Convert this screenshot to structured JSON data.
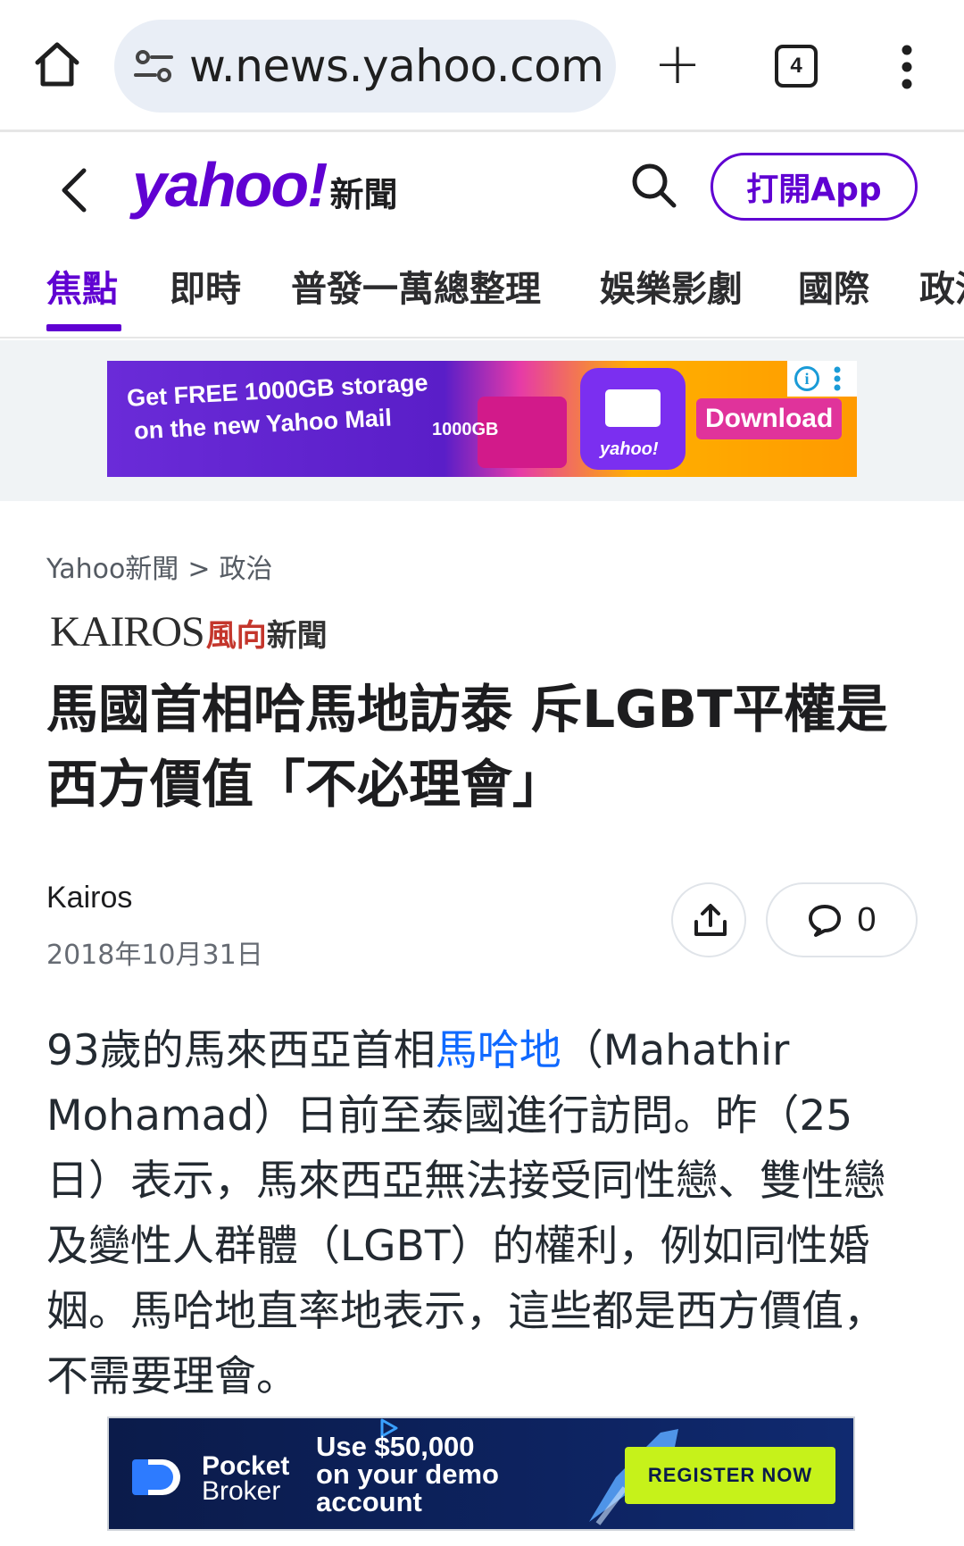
{
  "browser": {
    "url": "w.news.yahoo.com",
    "tab_count": "4"
  },
  "header": {
    "logo_text": "yahoo!",
    "logo_sub": "新聞",
    "open_app": "打開App"
  },
  "nav": {
    "items": [
      {
        "label": "焦點",
        "active": true
      },
      {
        "label": "即時"
      },
      {
        "label": "普發一萬總整理"
      },
      {
        "label": "娛樂影劇"
      },
      {
        "label": "國際"
      },
      {
        "label": "政治"
      }
    ]
  },
  "ad_top": {
    "line1": "Get FREE 1000GB storage",
    "line2": "on the new Yahoo Mail",
    "storage": "1000GB",
    "brand": "yahoo!",
    "download": "Download"
  },
  "breadcrumb": {
    "root": "Yahoo新聞",
    "separator": ">",
    "section": "政治"
  },
  "publisher": {
    "name_latin": "KAIROS",
    "name_zh_accent": "風向",
    "name_zh": "新聞"
  },
  "article": {
    "headline": "馬國首相哈馬地訪泰 斥LGBT平權是西方價值「不必理會」",
    "author": "Kairos",
    "date": "2018年10月31日",
    "comment_count": "0",
    "body_before_link": "93歲的馬來西亞首相",
    "body_link": "馬哈地",
    "body_after_link": "（Mahathir Mohamad）日前至泰國進行訪問。昨（25日）表示，馬來西亞無法接受同性戀、雙性戀及變性人群體（LGBT）的權利，例如同性婚姻。馬哈地直率地表示，這些都是西方價值，不需要理會。"
  },
  "ad_bottom": {
    "brand_line1": "Pocket",
    "brand_line2": "Broker",
    "offer_line1": "Use $50,000",
    "offer_line2": "on your demo",
    "offer_line3": "account",
    "cta": "REGISTER NOW"
  },
  "colors": {
    "brand_purple": "#6001d2",
    "link_blue": "#0f69ff",
    "kairos_red": "#c4362c",
    "cta_green": "#c6f21a"
  }
}
